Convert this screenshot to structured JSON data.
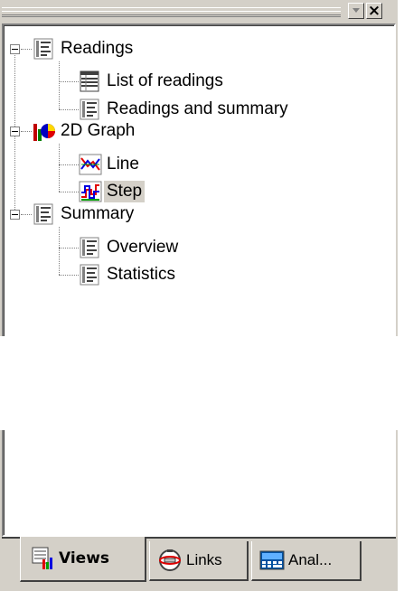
{
  "panel": {
    "dropdown_icon": "chevron-down-icon",
    "close_glyph": "×"
  },
  "tree": {
    "groups": [
      {
        "label": "Readings",
        "icon": "report-icon",
        "children": [
          {
            "label": "List of readings",
            "icon": "table-icon"
          },
          {
            "label": "Readings and summary",
            "icon": "report-icon"
          }
        ]
      },
      {
        "label": "2D Graph",
        "icon": "chart-icon",
        "children": [
          {
            "label": "Line",
            "icon": "line-graph-icon"
          },
          {
            "label": "Step",
            "icon": "step-graph-icon",
            "selected": true
          }
        ]
      },
      {
        "label": "Summary",
        "icon": "report-icon",
        "children": [
          {
            "label": "Overview",
            "icon": "report-icon"
          },
          {
            "label": "Statistics",
            "icon": "report-icon"
          }
        ]
      }
    ]
  },
  "tabs": [
    {
      "label": "Views",
      "icon": "views-icon",
      "active": true
    },
    {
      "label": "Links",
      "icon": "links-icon",
      "active": false
    },
    {
      "label": "Anal...",
      "icon": "analysis-icon",
      "active": false
    }
  ],
  "colors": {
    "face": "#d4d0c8",
    "selected_bg": "#d4d0c8"
  }
}
